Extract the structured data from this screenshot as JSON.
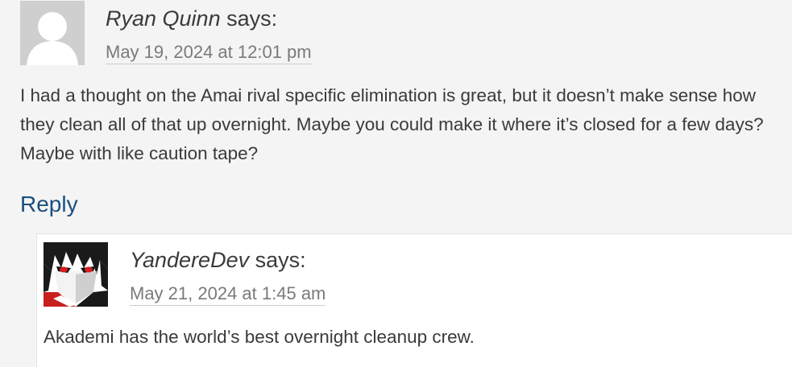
{
  "parent_comment": {
    "author": "Ryan Quinn",
    "says": "says:",
    "date": "May 19, 2024 at 12:01 pm",
    "body": "I had a thought on the Amai rival specific elimination is great, but it doesn’t make sense how they clean all of that up overnight. Maybe you could make it where it’s closed for a few days? Maybe with like caution tape?",
    "reply_label": "Reply",
    "avatar": "default-person-avatar-icon"
  },
  "child_comment": {
    "author": "YandereDev",
    "says": "says:",
    "date": "May 21, 2024 at 1:45 am",
    "body": "Akademi has the world’s best overnight cleanup crew.",
    "avatar": "anime-character-avatar"
  },
  "colors": {
    "background": "#f4f4f4",
    "text": "#3a3a3a",
    "meta": "#7a7a7a",
    "link": "#1b4f7e",
    "child_background": "#ffffff"
  }
}
